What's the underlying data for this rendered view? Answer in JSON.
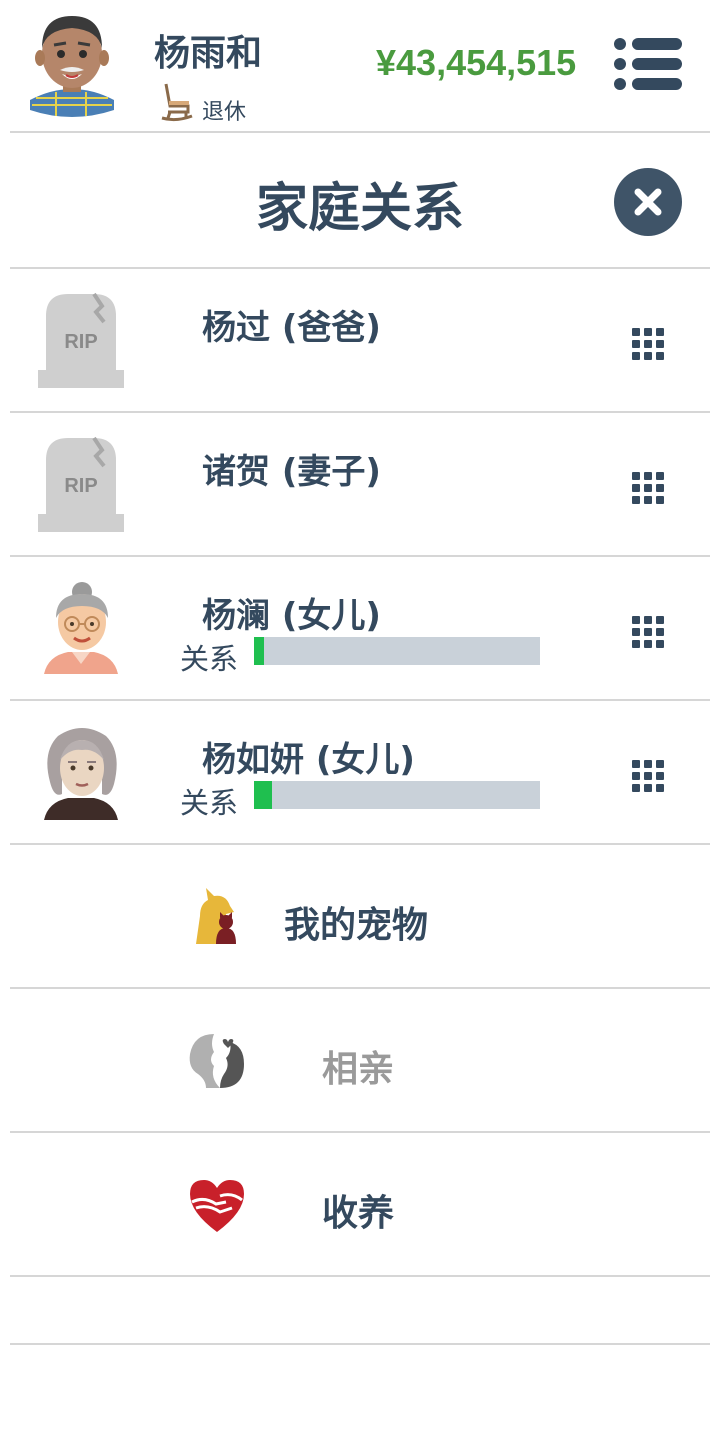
{
  "header": {
    "player_name": "杨雨和",
    "status": "退休",
    "money": "¥43,454,515"
  },
  "page": {
    "title": "家庭关系"
  },
  "family": [
    {
      "name": "杨过 (爸爸)",
      "deceased": true,
      "tombstone_text": "RIP"
    },
    {
      "name": "诸贺 (妻子)",
      "deceased": true,
      "tombstone_text": "RIP"
    },
    {
      "name": "杨澜 (女儿)",
      "deceased": false,
      "relationship_label": "关系",
      "relationship_level": 0.04
    },
    {
      "name": "杨如妍 (女儿)",
      "deceased": false,
      "relationship_label": "关系",
      "relationship_level": 0.07
    }
  ],
  "actions": [
    {
      "label": "我的宠物",
      "icon": "pets-icon",
      "enabled": true
    },
    {
      "label": "相亲",
      "icon": "dating-icon",
      "enabled": false
    },
    {
      "label": "收养",
      "icon": "adoption-heart-icon",
      "enabled": true
    }
  ],
  "colors": {
    "text": "#34495e",
    "money": "#4a9b3f",
    "bar_bg": "#c9d1d9",
    "bar_fill": "#1fbf4f",
    "disabled": "#9a9a9a"
  }
}
